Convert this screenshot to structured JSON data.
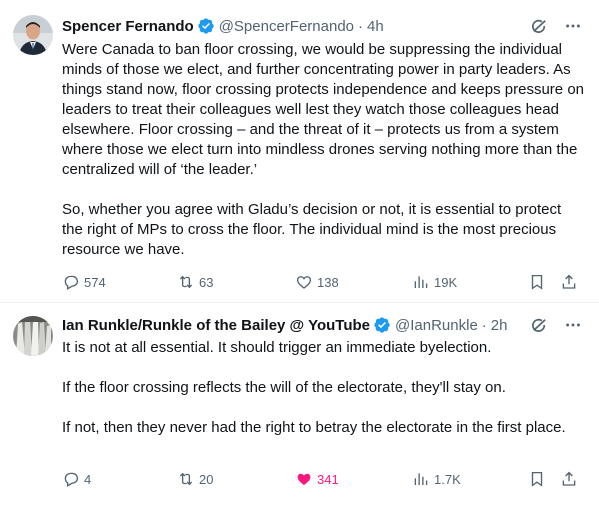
{
  "tweets": [
    {
      "author": "Spencer Fernando",
      "handle": "@SpencerFernando",
      "time": "4h",
      "verified_color": "#1d9bf0",
      "text": [
        "Were Canada to ban floor crossing, we would be suppressing the individual minds of those we elect, and further concentrating power in party leaders. As things stand now, floor crossing protects independence and keeps pressure on leaders to treat their colleagues well lest they watch those colleagues head elsewhere. Floor crossing – and the threat of it – protects us from a system where those we elect turn into mindless drones serving nothing more than the centralized will of ‘the leader.’",
        "So, whether you agree with Gladu’s decision or not, it is essential to protect the right of MPs to cross the floor. The individual mind is the most precious resource we have."
      ],
      "replies": "574",
      "retweets": "63",
      "likes": "138",
      "views": "19K",
      "liked": false
    },
    {
      "author": "Ian Runkle/Runkle of the Bailey @ YouTube",
      "handle": "@IanRunkle",
      "time": "2h",
      "verified_color": "#1d9bf0",
      "text": [
        "It is not at all essential.  It should trigger an immediate byelection.",
        "If the floor crossing reflects the will of the electorate, they'll stay on.",
        "If not, then they never had the right to betray the electorate in the first place."
      ],
      "replies": "4",
      "retweets": "20",
      "likes": "341",
      "views": "1.7K",
      "liked": true
    }
  ],
  "icons": {
    "verified": "verified-badge-icon",
    "grok": "grok-icon",
    "more": "more-icon",
    "reply": "reply-icon",
    "retweet": "retweet-icon",
    "like": "heart-icon",
    "views": "views-icon",
    "bookmark": "bookmark-icon",
    "share": "share-icon"
  },
  "colors": {
    "text": "#0f1419",
    "muted": "#536471",
    "like_active": "#f91880",
    "verified": "#1d9bf0"
  }
}
